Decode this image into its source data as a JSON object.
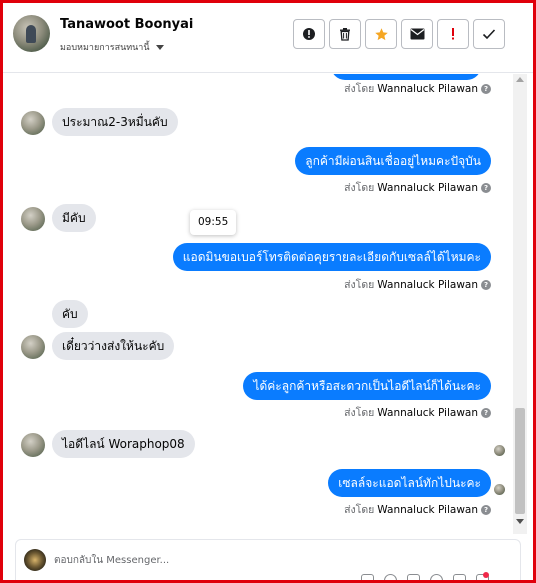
{
  "header": {
    "contact_name": "Tanawoot Boonyai",
    "subtitle": "มอบหมายการสนทนานี้",
    "actions": [
      {
        "icon": "alert-circle-icon"
      },
      {
        "icon": "trash-icon"
      },
      {
        "icon": "star-icon",
        "color": "#f5a623"
      },
      {
        "icon": "envelope-icon"
      },
      {
        "icon": "exclamation-icon",
        "color": "#e0000b"
      },
      {
        "icon": "check-icon"
      }
    ]
  },
  "messages": {
    "sent_prefix": "ส่งโดย",
    "sender": "Wannaluck Pilawan",
    "help_icon": "?",
    "tooltip_time": "09:55",
    "in_1": "ประมาณ2-3หมื่นคับ",
    "out_1": "ลูกค้ามีผ่อนสินเชื่ออยู่ไหมคะปัจุบัน",
    "in_2": "มีคับ",
    "out_2": "แอดมินขอเบอร์โทรติดต่อคุยรายละเอียดกับเซลล์ได้ไหมคะ",
    "in_3a": "คับ",
    "in_3b": "เดี๋ยวว่างส่งให้นะคับ",
    "out_3": "ได้ค่ะลูกค้าหรือสะดวกเป็นไอดีไลน์ก็ได้นะคะ",
    "in_4": "ไอดีไลน์ Woraphop08",
    "out_4": "เซลล์จะแอดไลน์ทักไปนะคะ"
  },
  "composer": {
    "placeholder": "ตอบกลับใน Messenger..."
  },
  "colors": {
    "frame": "#e0000b",
    "outgoing_bubble": "#0a7cff",
    "incoming_bubble": "#e4e6eb"
  }
}
